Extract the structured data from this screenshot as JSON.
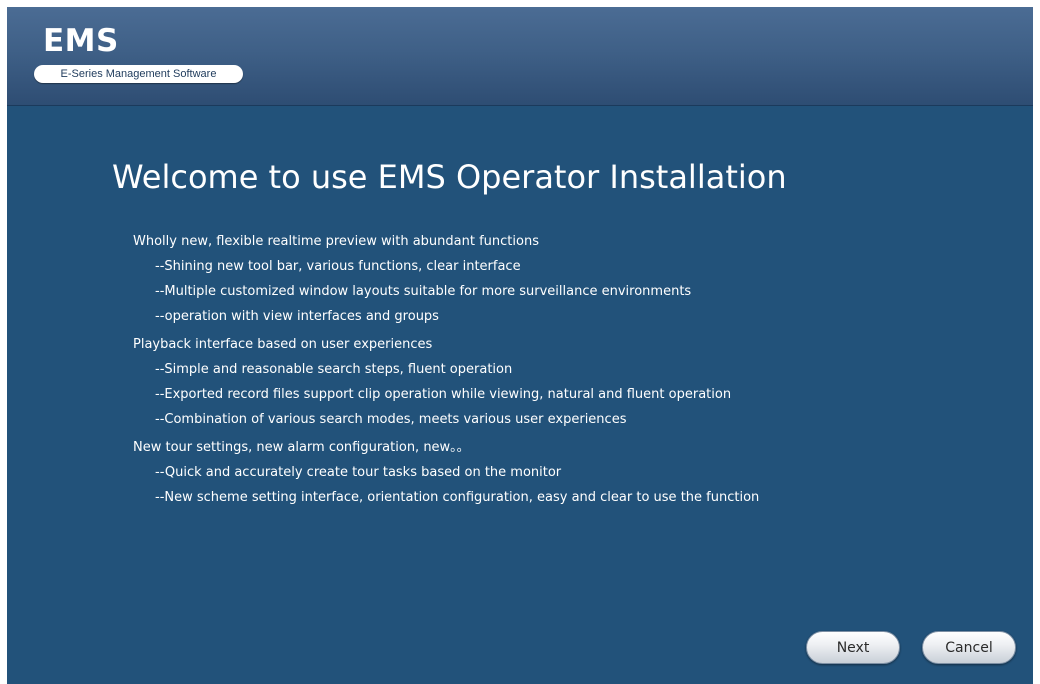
{
  "header": {
    "logo": "EMS",
    "subtitle": "E-Series Management Software"
  },
  "main": {
    "title": "Welcome to use EMS Operator Installation",
    "feature_groups": [
      {
        "heading": "Wholly new, flexible realtime preview with abundant functions",
        "items": [
          "--Shining new tool bar, various functions, clear interface",
          "--Multiple customized window layouts suitable for more surveillance environments",
          "--operation with view interfaces and groups"
        ]
      },
      {
        "heading": "Playback interface based on user experiences",
        "items": [
          "--Simple and reasonable search steps, fluent operation",
          "--Exported record files support clip operation while viewing, natural and fluent operation",
          "--Combination of various search modes, meets various user experiences"
        ]
      },
      {
        "heading": "New tour settings, new alarm configuration, new。。",
        "items": [
          "--Quick and accurately create tour tasks based on the monitor",
          "--New scheme setting interface, orientation configuration, easy and clear to use the function"
        ]
      }
    ]
  },
  "buttons": {
    "next": "Next",
    "cancel": "Cancel"
  },
  "colors": {
    "background": "#22527a",
    "header_top": "#4b6c94",
    "text": "#ffffff"
  }
}
